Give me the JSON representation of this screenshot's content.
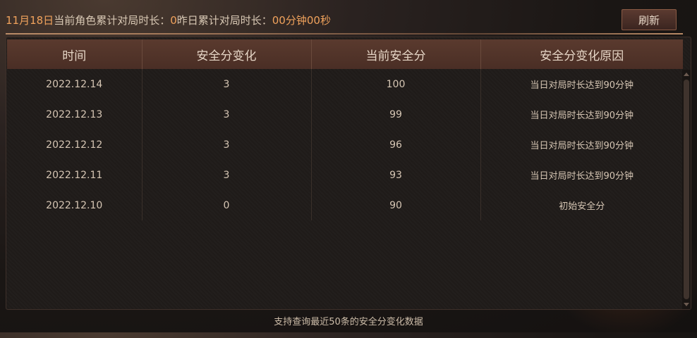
{
  "header": {
    "info": {
      "date": "11月18日",
      "today_label": "当前角色累计对局时长：",
      "today_value": "0",
      "yesterday_label": "昨日累计对局时长：",
      "yesterday_value": "00分钟00秒"
    },
    "refresh_label": "刷新"
  },
  "table": {
    "columns": [
      "时间",
      "安全分变化",
      "当前安全分",
      "安全分变化原因"
    ],
    "rows": [
      {
        "time": "2022.12.14",
        "change": "3",
        "score": "100",
        "reason": "当日对局时长达到90分钟"
      },
      {
        "time": "2022.12.13",
        "change": "3",
        "score": "99",
        "reason": "当日对局时长达到90分钟"
      },
      {
        "time": "2022.12.12",
        "change": "3",
        "score": "96",
        "reason": "当日对局时长达到90分钟"
      },
      {
        "time": "2022.12.11",
        "change": "3",
        "score": "93",
        "reason": "当日对局时长达到90分钟"
      },
      {
        "time": "2022.12.10",
        "change": "0",
        "score": "90",
        "reason": "初始安全分"
      }
    ]
  },
  "footer": {
    "note": "支持查询最近50条的安全分变化数据"
  },
  "colors": {
    "highlight": "#f0a25c",
    "header_bg": "#5a3a2e",
    "panel_bg": "#1f1b19",
    "text": "#d6c6b4"
  }
}
